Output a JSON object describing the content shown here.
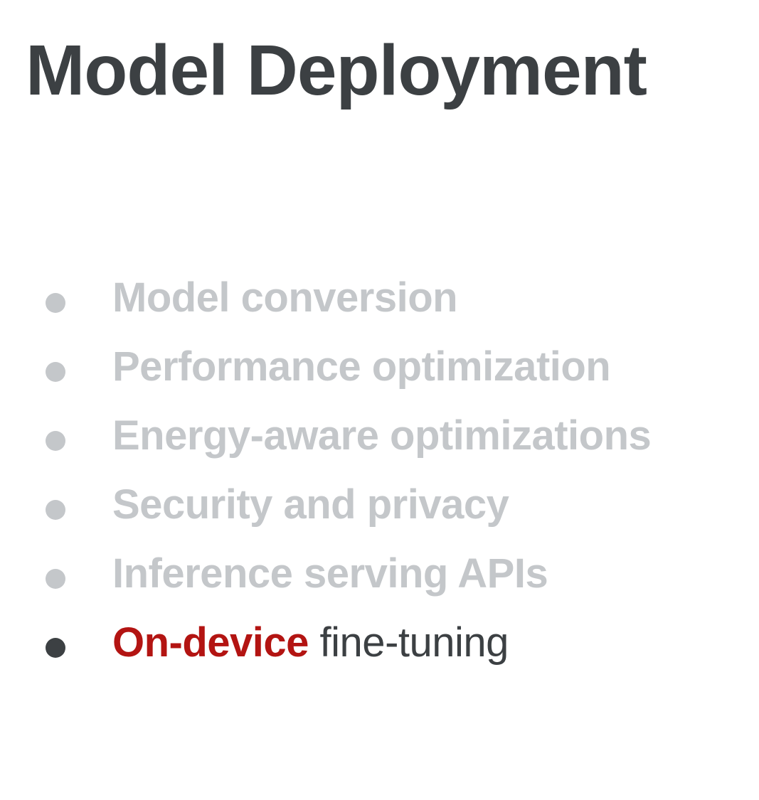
{
  "slide": {
    "title": "Model Deployment",
    "bullets": [
      {
        "text": "Model conversion",
        "state": "dimmed"
      },
      {
        "text": "Performance optimization",
        "state": "dimmed"
      },
      {
        "text": "Energy-aware optimizations",
        "state": "dimmed"
      },
      {
        "text": "Security and privacy",
        "state": "dimmed"
      },
      {
        "text": "Inference serving APIs",
        "state": "dimmed"
      },
      {
        "highlight": "On-device",
        "rest": " fine-tuning",
        "state": "active"
      }
    ]
  },
  "colors": {
    "title": "#3c4043",
    "dimmed_text": "#c4c7ca",
    "active_text": "#3c4043",
    "highlight": "#b31412",
    "background": "#ffffff"
  }
}
